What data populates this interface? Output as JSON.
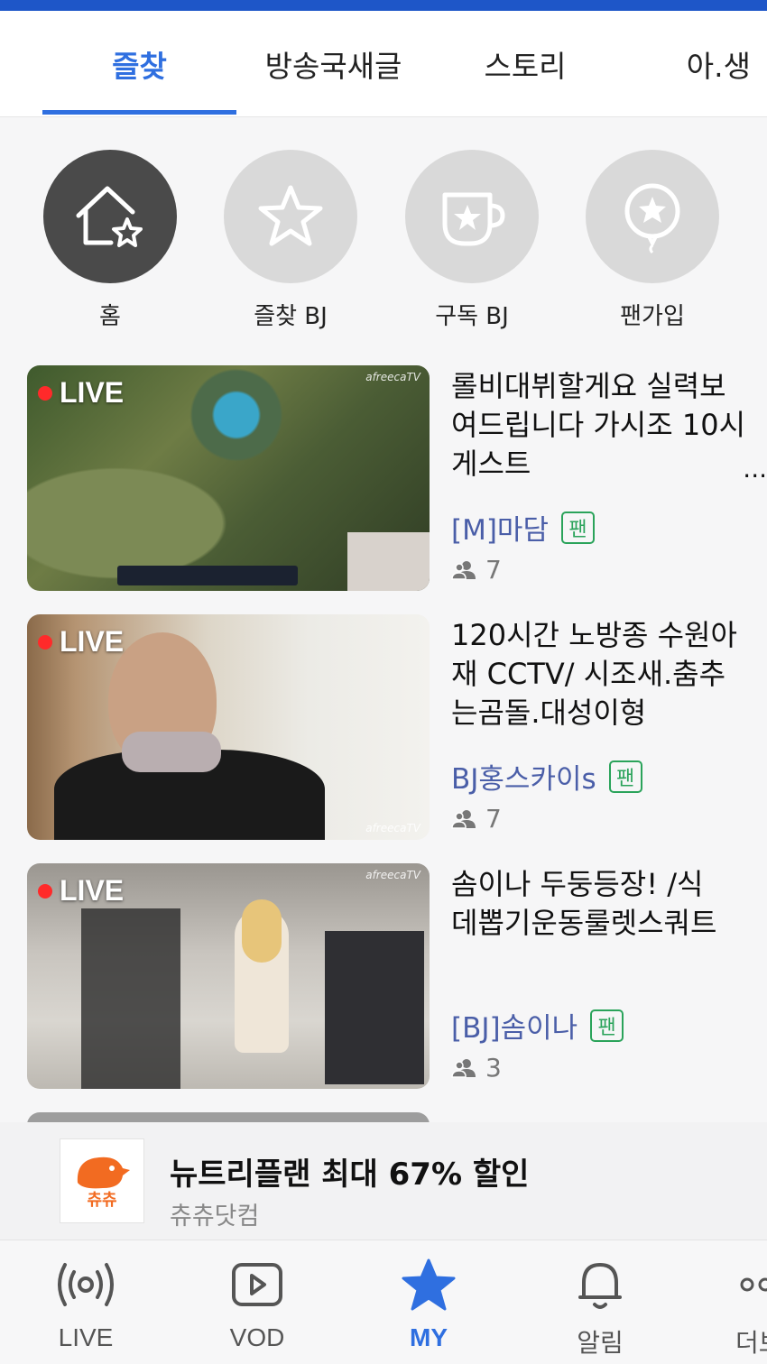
{
  "tabs": [
    {
      "label": "즐찾",
      "active": true
    },
    {
      "label": "방송국새글"
    },
    {
      "label": "스토리"
    },
    {
      "label": "아.생"
    }
  ],
  "categories": [
    {
      "label": "홈",
      "icon": "home-star-icon",
      "active": true
    },
    {
      "label": "즐찾 BJ",
      "icon": "star-icon"
    },
    {
      "label": "구독 BJ",
      "icon": "cup-star-icon"
    },
    {
      "label": "팬가입",
      "icon": "balloon-star-icon"
    }
  ],
  "streams": [
    {
      "badge": "LIVE",
      "watermark": "afreecaTV",
      "title": "롤비대뷔할게요 실력보\n여드립니다 가시조 10시\n게스트",
      "more": "...",
      "bj": "[M]마담",
      "fan": "팬",
      "viewers": "7"
    },
    {
      "badge": "LIVE",
      "watermark": "afreecaTV",
      "title": "120시간 노방종 수원아\n재 CCTV/ 시조새.춤추\n는곰돌.대성이형",
      "more": "",
      "bj": "BJ홍스카이s",
      "fan": "팬",
      "viewers": "7"
    },
    {
      "badge": "LIVE",
      "watermark": "afreecaTV",
      "title": "솜이나 두둥등장!   /식\n데뽑기운동룰렛스쿼트",
      "more": "",
      "bj": "[BJ]솜이나",
      "fan": "팬",
      "viewers": "3"
    }
  ],
  "ad": {
    "title": "뉴트리플랜 최대 67% 할인",
    "sub": "츄츄닷컴",
    "logo_text": "츄츄"
  },
  "nav": [
    {
      "label": "LIVE",
      "icon": "broadcast-icon"
    },
    {
      "label": "VOD",
      "icon": "play-icon"
    },
    {
      "label": "MY",
      "icon": "star-icon",
      "active": true
    },
    {
      "label": "알림",
      "icon": "bell-icon"
    },
    {
      "label": "더보",
      "icon": "more-icon"
    }
  ],
  "colors": {
    "accent": "#2f6fe0",
    "fan": "#2aa35a",
    "bj": "#4a5ea8",
    "live": "#ff2a2a"
  }
}
